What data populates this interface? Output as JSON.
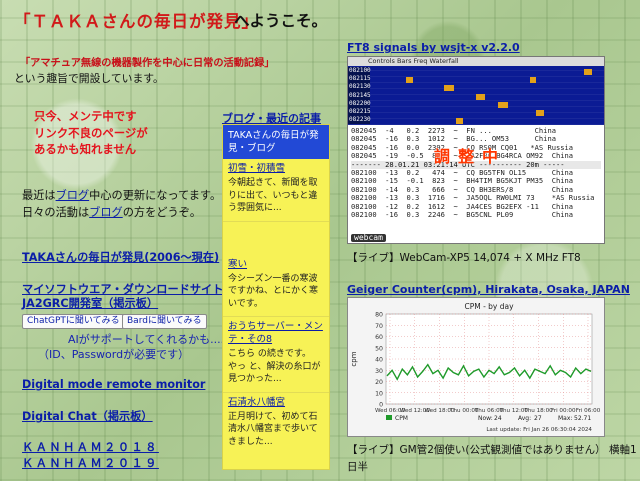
{
  "header": {
    "site_title": "「ＴＡＫＡさんの毎日が発見」",
    "welcome": "へようこそ。"
  },
  "intro": {
    "purpose_quote": "「アマチュア無線の機器製作を中心に日常の活動記録」",
    "purpose_text": "という趣旨で開設しています。",
    "maintenance_lines": [
      "只今、メンテ中です",
      "リンク不良のページが",
      "あるかも知れません"
    ],
    "blog_note_1_before": "最近は",
    "blog_note_1_link": "ブログ",
    "blog_note_1_after": "中心の更新になってます。",
    "blog_note_2_before": "日々の活動は",
    "blog_note_2_link": "ブログ",
    "blog_note_2_after": "の方をどうぞ。"
  },
  "links": {
    "taka_archive": "TAKAさんの毎日が発見(2006～現在)",
    "software_download": "マイソフトウエア・ダウンロードサイト",
    "ja2grc": "JA2GRC開発室（掲示板）",
    "chatgpt_button": "ChatGPTに聞いてみる",
    "bard_button": "Bardに聞いてみる",
    "ai_note_1": "AIがサポートしてくれるかも.....",
    "ai_note_2": "（ID、Passwordが必要です）",
    "digital_mode": "Digital mode remote monitor",
    "digital_chat": "Digital Chat（掲示板）",
    "kanham_2018": "ＫＡＮＨＡＭ２０１８",
    "kanham_2019": "ＫＡＮＨＡＭ２０１９"
  },
  "blog": {
    "heading": "ブログ・最近の記事",
    "panel_title": "TAKAさんの毎日が発見・ブログ",
    "entries": [
      {
        "title": "初雪・初積雪",
        "body": "今朝起きて、新聞を取りに出て、いつもと違う雰囲気に..."
      },
      {
        "title": "寒い",
        "body": "今シーズン一番の寒波ですかね、とにかく寒いです。"
      },
      {
        "title": "おうちサーバー・メンテ・その8",
        "body": "こちら の続きです。　やっ と、解決の糸口が見つかった..."
      },
      {
        "title": "石清水八幡宮",
        "body": "正月明けて、初めて石清水八幡宮まで歩いてきました..."
      }
    ]
  },
  "ft8": {
    "link": "FT8 signals by wsjt-x v2.2.0",
    "menubar": "Controls  Bars         Freq              Waterfall",
    "times": [
      "082100",
      "082115",
      "082130",
      "082145",
      "082200",
      "082215",
      "082230"
    ],
    "decodes": [
      "082045  -4   0.2  2273  ~  FN ...          China",
      "082045  -16  0.3  1012  ~  BG... OM53      China",
      "082045  -16  0.0  2392  ~  CQ RS0M CQ01   *AS Russia",
      "082045  -19  -0.5  820  ~  JA2FRC BG4RCA OM92  China",
      "------- 28.01.21 03:21:14 UTC ---------- 20m -----",
      "082100  -13  0.2   474  ~  CQ BG5TFN OL15      China",
      "082100  -15  -0.1  823  ~  BH4TIM BG5KJT PM35  China",
      "082100  -14  0.3   666  ~  CQ BH3ERS/8         China",
      "082100  -13  0.3  1716  ~  JA5OQL RW0LMI 73    *AS Russia",
      "082100  -12  0.2  1612  ~  JA4CES BG2EFX -11   China",
      "082100  -16  0.3  2246  ~  BG5CNL PL09         China"
    ],
    "overlay": "調整中",
    "badge": "webcam",
    "caption": "【ライブ】WebCam-XP5 14,074 + X MHz FT8"
  },
  "geiger": {
    "link": "Geiger Counter(cpm), Hirakata, Osaka, JAPAN",
    "caption": "【ライブ】GM管2個使い(公式観測値ではありません） 横軸1",
    "caption_2": "日半"
  },
  "chart_data": {
    "type": "line",
    "title": "CPM - by day",
    "ylabel": "cpm",
    "xlabel": "",
    "x": [
      "Wed 06:00",
      "Wed 12:00",
      "Wed 18:00",
      "Thu 00:00",
      "Thu 06:00",
      "Thu 12:00",
      "Thu 18:00",
      "Fri 00:00",
      "Fri 06:00"
    ],
    "ylim": [
      0,
      80
    ],
    "yticks": [
      0,
      10,
      20,
      30,
      40,
      50,
      60,
      70,
      80
    ],
    "series": [
      {
        "name": "CPM",
        "values": [
          25,
          30,
          22,
          31,
          26,
          33,
          24,
          29,
          35,
          27,
          30,
          23,
          32,
          28,
          26,
          34,
          25,
          29,
          31,
          24,
          30,
          27,
          33,
          26,
          28,
          32,
          25,
          30,
          23,
          31,
          29,
          27,
          34,
          26,
          30,
          28,
          24,
          32,
          27,
          31,
          29
        ]
      }
    ],
    "legend_rows": [
      "Now:",
      "Avg:",
      "Max:"
    ],
    "legend_values": [
      "24",
      "27",
      "52.71"
    ],
    "footer": "Last update: Fri Jan 26 06:30:04 2024",
    "line_color": "#1f9a2a"
  }
}
